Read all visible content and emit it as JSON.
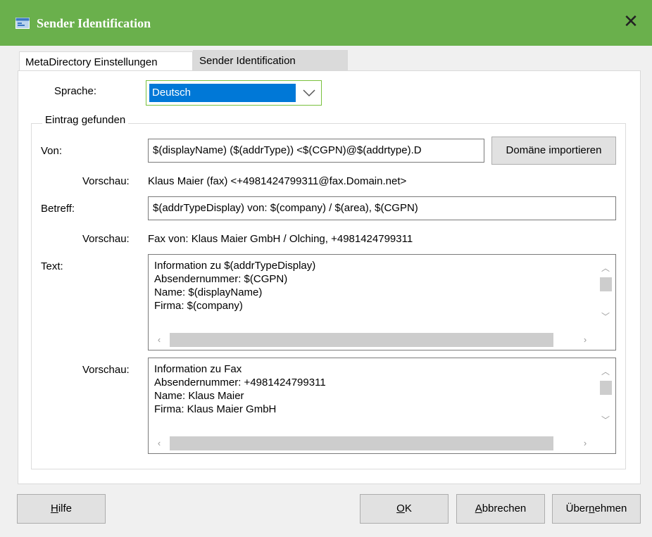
{
  "window": {
    "title": "Sender Identification",
    "close_glyph": "✕"
  },
  "tabs": [
    {
      "label": "MetaDirectory Einstellungen"
    },
    {
      "label": "Sender Identification"
    }
  ],
  "sprache": {
    "label": "Sprache:",
    "value": "Deutsch"
  },
  "group": {
    "legend": "Eintrag gefunden"
  },
  "von": {
    "label": "Von:",
    "value": "$(displayName) ($(addrType)) <$(CGPN)@$(addrtype).D",
    "import_button": "Domäne importieren",
    "preview_label": "Vorschau:",
    "preview_value": "Klaus Maier (fax) <+4981424799311@fax.Domain.net>"
  },
  "betreff": {
    "label": "Betreff:",
    "value": "$(addrTypeDisplay) von: $(company) / $(area), $(CGPN)",
    "preview_label": "Vorschau:",
    "preview_value": "Fax von: Klaus Maier GmbH / Olching, +4981424799311"
  },
  "text": {
    "label": "Text:",
    "lines": [
      "Information zu $(addrTypeDisplay)",
      "Absendernummer: $(CGPN)",
      "Name: $(displayName)",
      "Firma: $(company)"
    ],
    "preview_label": "Vorschau:",
    "preview_lines": [
      "Information zu Fax",
      "Absendernummer: +4981424799311",
      "Name: Klaus Maier",
      "Firma: Klaus Maier GmbH"
    ]
  },
  "buttons": {
    "help": {
      "mnemonic": "H",
      "rest": "ilfe"
    },
    "ok": {
      "mnemonic": "O",
      "rest": "K"
    },
    "cancel": {
      "mnemonic": "A",
      "rest": "bbrechen"
    },
    "apply": {
      "before": "Über",
      "mnemonic": "n",
      "rest": "ehmen"
    }
  },
  "colors": {
    "titlebar": "#6ab04c",
    "selection": "#0078d7",
    "focus_border": "#79c13d"
  }
}
